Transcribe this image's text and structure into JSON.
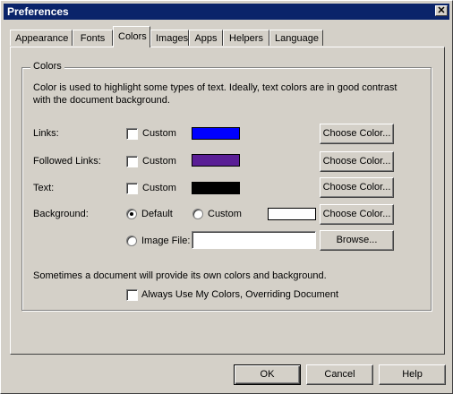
{
  "window": {
    "title": "Preferences",
    "close_glyph": "✕"
  },
  "tabs": [
    "Appearance",
    "Fonts",
    "Colors",
    "Images",
    "Apps",
    "Helpers",
    "Language"
  ],
  "active_tab": "Colors",
  "group": {
    "title": "Colors",
    "description_line1": "Color is used to highlight some types of text.  Ideally, text colors are in good contrast",
    "description_line2": "with the document background."
  },
  "rows": {
    "links": {
      "label": "Links:",
      "custom_label": "Custom",
      "swatch_color": "#0000ff",
      "button": "Choose Color..."
    },
    "followed": {
      "label": "Followed Links:",
      "custom_label": "Custom",
      "swatch_color": "#5a1e96",
      "button": "Choose Color..."
    },
    "text": {
      "label": "Text:",
      "custom_label": "Custom",
      "swatch_color": "#000000",
      "button": "Choose Color..."
    },
    "background": {
      "label": "Background:",
      "default_label": "Default",
      "custom_label": "Custom",
      "swatch_color": "#ffffff",
      "button": "Choose Color..."
    },
    "image_file": {
      "label": "Image File:",
      "value": "",
      "button": "Browse..."
    }
  },
  "note": "Sometimes a document will provide its own colors and background.",
  "always_use": "Always Use My Colors, Overriding Document",
  "footer": {
    "ok": "OK",
    "cancel": "Cancel",
    "help": "Help"
  }
}
